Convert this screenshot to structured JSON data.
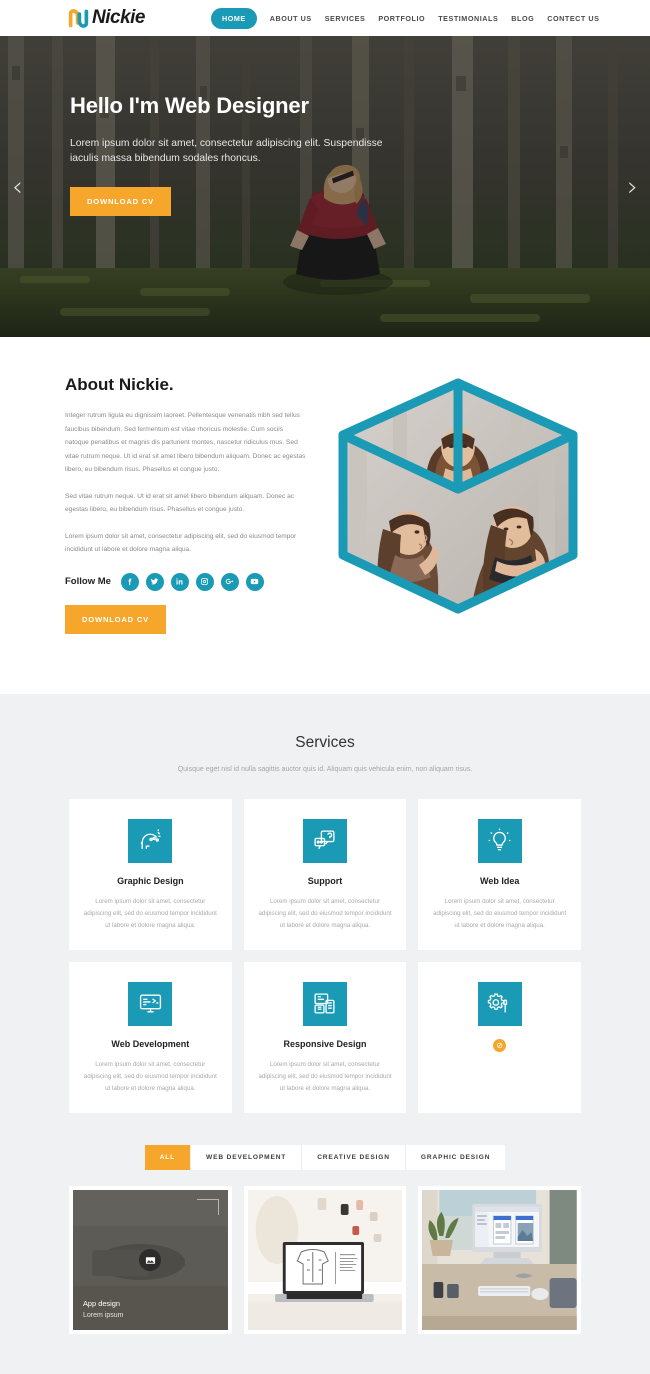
{
  "header": {
    "logo_text": "Nickie",
    "logo_icon": "n-monogram-icon",
    "nav": [
      {
        "label": "HOME",
        "active": true
      },
      {
        "label": "ABOUT US",
        "active": false
      },
      {
        "label": "SERVICES",
        "active": false
      },
      {
        "label": "PORTFOLIO",
        "active": false
      },
      {
        "label": "TESTIMONIALS",
        "active": false
      },
      {
        "label": "BLOG",
        "active": false
      },
      {
        "label": "CONTECT US",
        "active": false
      }
    ]
  },
  "hero": {
    "title": "Hello I'm Web Designer",
    "subtitle": "Lorem ipsum dolor sit amet, consectetur adipiscing elit. Suspendisse iaculis massa bibendum sodales rhoncus.",
    "cta": "DOWNLOAD CV",
    "prev_arrow": "‹",
    "next_arrow": "›"
  },
  "about": {
    "title": "About Nickie.",
    "paragraphs": [
      "Integer rutrum ligula eu dignissim laoreet. Pellentesque venenatis nibh sed tellus faucibus bibendum. Sed fermentum est vitae rhoncus molestie. Cum sociis natoque penatibus et magnis dis parturient montes, nascetur ridiculus mus. Sed vitae rutrum neque. Ut id erat sit amet libero bibendum aliquam. Donec ac egestas libero, eu bibendum risus. Phasellus et congue justo.",
      "Sed vitae rutrum neque. Ut id erat sit amet libero bibendum aliquam. Donec ac egestas libero, eu bibendum risus. Phasellus et congue justo.",
      "Lorem ipsum dolor sit amet, consectetur adipiscing elit, sed do eiusmod tempor incididunt ut labore et dolore magna aliqua."
    ],
    "follow_label": "Follow Me",
    "socials": [
      {
        "name": "facebook-icon"
      },
      {
        "name": "twitter-icon"
      },
      {
        "name": "linkedin-icon"
      },
      {
        "name": "instagram-icon"
      },
      {
        "name": "google-plus-icon"
      },
      {
        "name": "youtube-icon"
      }
    ],
    "cta": "DOWNLOAD CV",
    "cube_alt": "three-photo-cube"
  },
  "services": {
    "title": "Services",
    "subtitle": "Quisque eget nisl id nulla sagittis auctor quis id. Aliquam quis vehicula enim, non aliquam risus.",
    "body_text": "Lorem ipsum dolor sit amet, consectetur adipiscing elit, sed do eiusmod tempor incididunt ut labore et dolore magna aliqua.",
    "cards": [
      {
        "icon": "head-idea-icon",
        "title": "Graphic Design"
      },
      {
        "icon": "chat-support-icon",
        "title": "Support"
      },
      {
        "icon": "lightbulb-icon",
        "title": "Web Idea"
      },
      {
        "icon": "monitor-code-icon",
        "title": "Web Development"
      },
      {
        "icon": "responsive-devices-icon",
        "title": "Responsive Design"
      },
      {
        "icon": "gear-screwdriver-icon",
        "title": "",
        "broken_glyph": "⊘"
      }
    ]
  },
  "portfolio": {
    "filters": [
      {
        "label": "ALL",
        "active": true
      },
      {
        "label": "WEB DEVELOPMENT",
        "active": false
      },
      {
        "label": "CREATIVE DESIGN",
        "active": false
      },
      {
        "label": "GRAPHIC DESIGN",
        "active": false
      }
    ],
    "items": [
      {
        "image": "app-design-thumbnail",
        "title": "App design",
        "subtitle": "Lorem ipsum",
        "hovered": true,
        "icon": "image-icon"
      },
      {
        "image": "laptop-fashion-sketch-thumbnail",
        "title": "",
        "subtitle": "",
        "hovered": false,
        "icon": ""
      },
      {
        "image": "imac-desk-thumbnail",
        "title": "",
        "subtitle": "",
        "hovered": false,
        "icon": ""
      }
    ]
  },
  "colors": {
    "teal": "#1b9ab5",
    "orange": "#f5a62b",
    "section_bg": "#f0f1f2",
    "card_bg": "#ffffff",
    "text_dark": "#222222",
    "text_muted": "#a9a9a9"
  }
}
